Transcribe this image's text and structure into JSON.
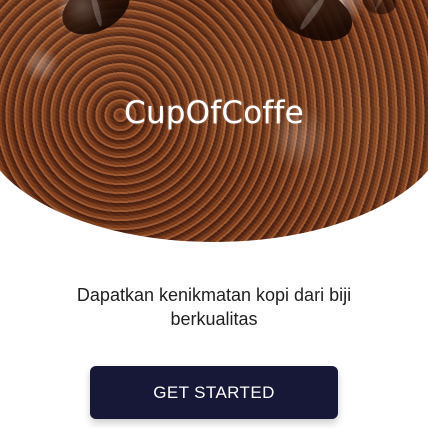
{
  "hero": {
    "brand_title": "CupOfCoffe"
  },
  "content": {
    "tagline": "Dapatkan kenikmatan kopi dari biji berkualitas"
  },
  "actions": {
    "get_started_label": "GET STARTED"
  },
  "colors": {
    "background": "#ffffff",
    "button": "#171737",
    "button_text": "#ffffff",
    "body_text": "#1f1f1f"
  }
}
